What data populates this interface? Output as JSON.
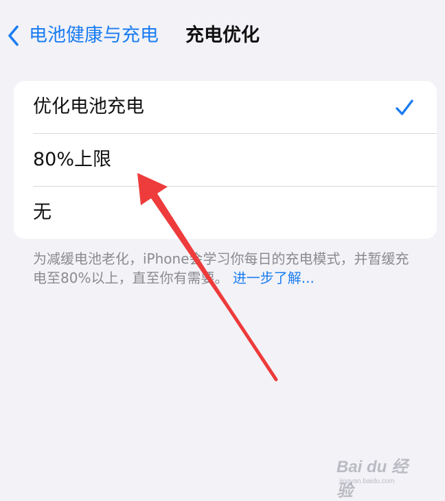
{
  "nav": {
    "back_label": "电池健康与充电",
    "title": "充电优化"
  },
  "options": [
    {
      "label": "优化电池充电",
      "selected": true
    },
    {
      "label": "80%上限",
      "selected": false
    },
    {
      "label": "无",
      "selected": false
    }
  ],
  "footer": {
    "text": "为减缓电池老化，iPhone会学习你每日的充电模式，并暂缓充电至80%以上，直至你有需要。",
    "link": "进一步了解..."
  },
  "watermark": {
    "brand": "Bai du 经验",
    "url": "jingyan.baidu.com"
  },
  "colors": {
    "accent": "#1a7cf2",
    "annotation_arrow": "#ee3b3b",
    "background": "#f2f2f7"
  },
  "icons": {
    "back": "chevron-left-icon",
    "check": "checkmark-icon"
  }
}
